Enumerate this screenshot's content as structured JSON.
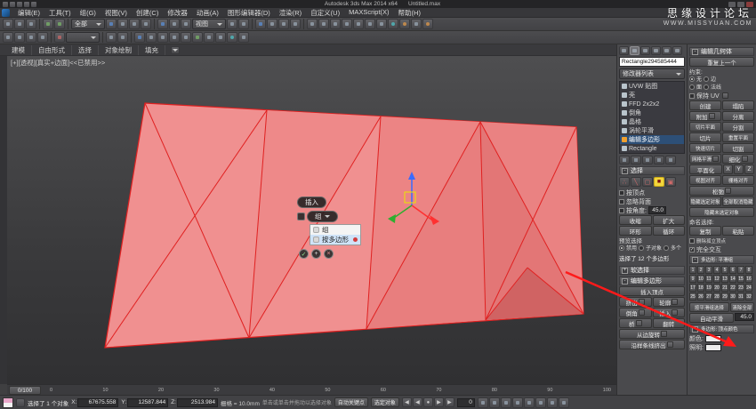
{
  "colors": {
    "mesh_fill": "#f09090",
    "mesh_edge": "#e02020",
    "annotation_red": "#ff1a1a",
    "active_yellow": "#f3d63c",
    "stack_selection_blue": "#2d4f77"
  },
  "window": {
    "app_title": "Autodesk 3ds Max 2014 x64",
    "doc_title": "Untitled.max"
  },
  "watermark": {
    "line1": "思缘设计论坛",
    "line2": "WWW.MISSYUAN.COM"
  },
  "menu": {
    "items": [
      "编辑(E)",
      "工具(T)",
      "组(G)",
      "视图(V)",
      "创建(C)",
      "修改器",
      "动画(A)",
      "图形编辑器(D)",
      "渲染(R)",
      "自定义(U)",
      "MAXScript(X)",
      "帮助(H)"
    ]
  },
  "toolbars": {
    "selection_filter": "全部",
    "coord_system": "视图"
  },
  "ribbon": {
    "tabs": [
      "建模",
      "自由形式",
      "选择",
      "对象绘制",
      "填充"
    ]
  },
  "viewport": {
    "label": "[+][透视][真实+边面]<<已禁用>>"
  },
  "caddy": {
    "title": "插入",
    "value": "组",
    "options": [
      "组",
      "按多边形"
    ],
    "ok": "✓",
    "apply": "+",
    "cancel": "×"
  },
  "panel": {
    "object_name": "Rectangle294585444",
    "modifier_list": "修改器列表",
    "stack": [
      "UVW 贴图",
      "壳",
      "FFD 2x2x2",
      "倒角",
      "晶格",
      "涡轮平滑",
      "编辑多边形",
      "Rectangle"
    ]
  },
  "selection": {
    "title": "选择",
    "by_vertex": "按顶点",
    "ignore_backfacing": "忽略背面",
    "by_angle": "按角度:",
    "angle_value": "45.0",
    "shrink": "收缩",
    "grow": "扩大",
    "ring": "环形",
    "loop": "循环",
    "preview_label": "预览选择",
    "preview_options": [
      "禁用",
      "子对象",
      "多个"
    ],
    "status": "选择了 12 个多边形"
  },
  "soft_selection_title": "软选择",
  "edit_poly": {
    "title": "编辑多边形",
    "insert_vertex": "插入顶点",
    "extrude": "挤出",
    "outline": "轮廓",
    "bevel": "倒角",
    "inset": "插入",
    "bridge": "桥",
    "flip": "翻转",
    "hinge": "从边旋转",
    "extrude_spline": "沿样条线挤出"
  },
  "edit_geometry": {
    "title": "编辑几何体",
    "repeat_last": "重复上一个",
    "constraints_label": "约束:",
    "constraints": [
      "无",
      "边",
      "面",
      "法线"
    ],
    "preserve_uv": "保持 UV",
    "create": "创建",
    "collapse": "塌陷",
    "attach": "附加",
    "detach": "分离",
    "slice_plane": "切片平面",
    "split": "分割",
    "slice": "切片",
    "reset_plane": "重置平面",
    "quickslice": "快速切片",
    "cut": "切割",
    "msmooth": "网格平滑",
    "tessellate": "细化",
    "make_planar": "平面化",
    "axis_x": "X",
    "axis_y": "Y",
    "axis_z": "Z",
    "view_align": "视图对齐",
    "grid_align": "栅格对齐",
    "relax": "松弛",
    "hide_selected": "隐藏选定对象",
    "unhide_all": "全部取消隐藏",
    "hide_unselected": "隐藏未选定对象",
    "named_selections": "命名选择:",
    "copy": "复制",
    "paste": "粘贴",
    "delete_isolated": "删除孤立顶点",
    "full_interactivity": "完全交互"
  },
  "smoothing": {
    "title": "多边形: 平滑组",
    "numbers": [
      "1",
      "2",
      "3",
      "4",
      "5",
      "6",
      "7",
      "8",
      "9",
      "10",
      "11",
      "12",
      "13",
      "14",
      "15",
      "16",
      "17",
      "18",
      "19",
      "20",
      "21",
      "22",
      "23",
      "24",
      "25",
      "26",
      "27",
      "28",
      "29",
      "30",
      "31",
      "32"
    ],
    "select_by": "按平滑组选择",
    "clear_all": "清除全部",
    "auto_smooth": "自动平滑",
    "auto_value": "45.0"
  },
  "vertex_colors": {
    "title": "多边形: 顶点颜色",
    "color_label": "颜色:",
    "illum_label": "照明:"
  },
  "timeline": {
    "slider": "0/100",
    "ticks": [
      "0",
      "10",
      "20",
      "30",
      "40",
      "50",
      "60",
      "70",
      "80",
      "90",
      "100"
    ]
  },
  "status": {
    "selection_text": "选择了 1 个对象",
    "x_label": "X:",
    "x_value": "67675.558",
    "y_label": "Y:",
    "y_value": "12587.844",
    "z_label": "Z:",
    "z_value": "2513.984",
    "grid_text": "栅格 = 10.0mm",
    "prompt": "单击或单击并拖动以选择对象",
    "auto_key": "自动关键点",
    "selected_only": "选定对象",
    "time_value": "0",
    "playback": [
      "◀",
      "◀",
      "●",
      "▶",
      "▶"
    ]
  }
}
